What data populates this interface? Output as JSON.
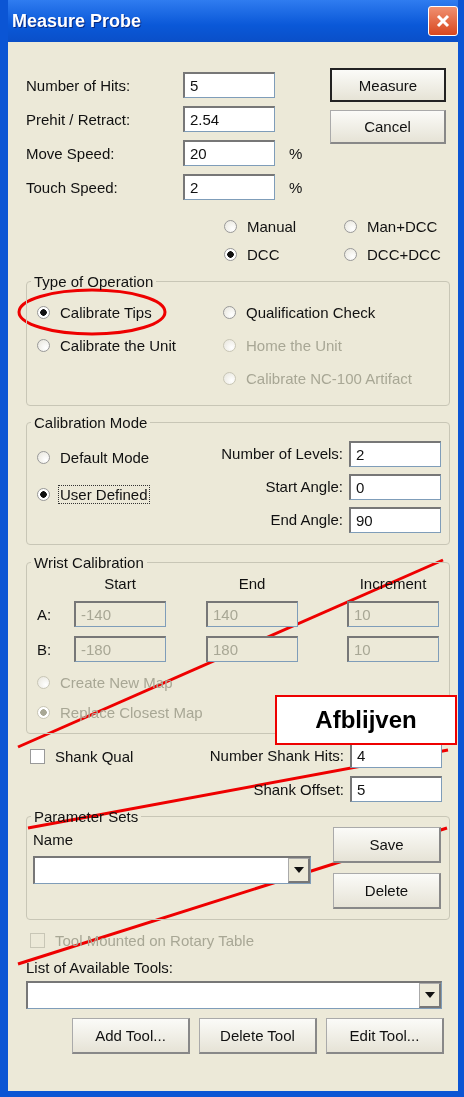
{
  "window": {
    "title": "Measure Probe"
  },
  "fields": [
    {
      "label": "Number of Hits:",
      "value": "5"
    },
    {
      "label": "Prehit / Retract:",
      "value": "2.54"
    },
    {
      "label": "Move Speed:",
      "value": "20",
      "unit": "%"
    },
    {
      "label": "Touch Speed:",
      "value": "2",
      "unit": "%"
    }
  ],
  "buttons": [
    {
      "label": "Measure",
      "default": true
    },
    {
      "label": "Cancel",
      "default": false
    }
  ],
  "mode_options": [
    {
      "label": "Manual",
      "selected": false
    },
    {
      "label": "Man+DCC",
      "selected": false
    },
    {
      "label": "DCC",
      "selected": true
    },
    {
      "label": "DCC+DCC",
      "selected": false
    }
  ],
  "type_of_operation": {
    "title": "Type of Operation",
    "left": [
      {
        "label": "Calibrate Tips",
        "selected": true,
        "disabled": false
      },
      {
        "label": "Calibrate the Unit",
        "selected": false,
        "disabled": false
      }
    ],
    "right": [
      {
        "label": "Qualification Check",
        "selected": false,
        "disabled": false
      },
      {
        "label": "Home the Unit",
        "selected": false,
        "disabled": true
      },
      {
        "label": "Calibrate NC-100 Artifact",
        "selected": false,
        "disabled": true
      }
    ]
  },
  "calibration_mode": {
    "title": "Calibration Mode",
    "options": [
      {
        "label": "Default Mode",
        "selected": false,
        "focused": false
      },
      {
        "label": "User Defined",
        "selected": true,
        "focused": true
      }
    ],
    "fields": [
      {
        "label": "Number of Levels:",
        "value": "2"
      },
      {
        "label": "Start Angle:",
        "value": "0"
      },
      {
        "label": "End Angle:",
        "value": "90"
      }
    ]
  },
  "wrist_calibration": {
    "title": "Wrist Calibration",
    "disabled": true,
    "columns": [
      "Start",
      "End",
      "Increment"
    ],
    "rows": [
      {
        "label": "A:",
        "values": [
          "-140",
          "140",
          "10"
        ]
      },
      {
        "label": "B:",
        "values": [
          "-180",
          "180",
          "10"
        ]
      }
    ],
    "options": [
      {
        "label": "Create New Map",
        "selected": false
      },
      {
        "label": "Replace Closest Map",
        "selected": true
      }
    ]
  },
  "shank": {
    "checkbox": {
      "label": "Shank Qual",
      "checked": false
    },
    "fields": [
      {
        "label": "Number Shank Hits:",
        "value": "4"
      },
      {
        "label": "Shank Offset:",
        "value": "5"
      }
    ]
  },
  "parameter_sets": {
    "title": "Parameter Sets",
    "name_label": "Name",
    "buttons": [
      "Save",
      "Delete"
    ]
  },
  "rotary_table": {
    "label": "Tool Mounted on Rotary Table",
    "checked": false,
    "disabled": true
  },
  "tools": {
    "label": "List of Available Tools:",
    "buttons": [
      "Add Tool...",
      "Delete Tool",
      "Edit Tool..."
    ]
  },
  "annotation": {
    "note": "Afblijven"
  }
}
